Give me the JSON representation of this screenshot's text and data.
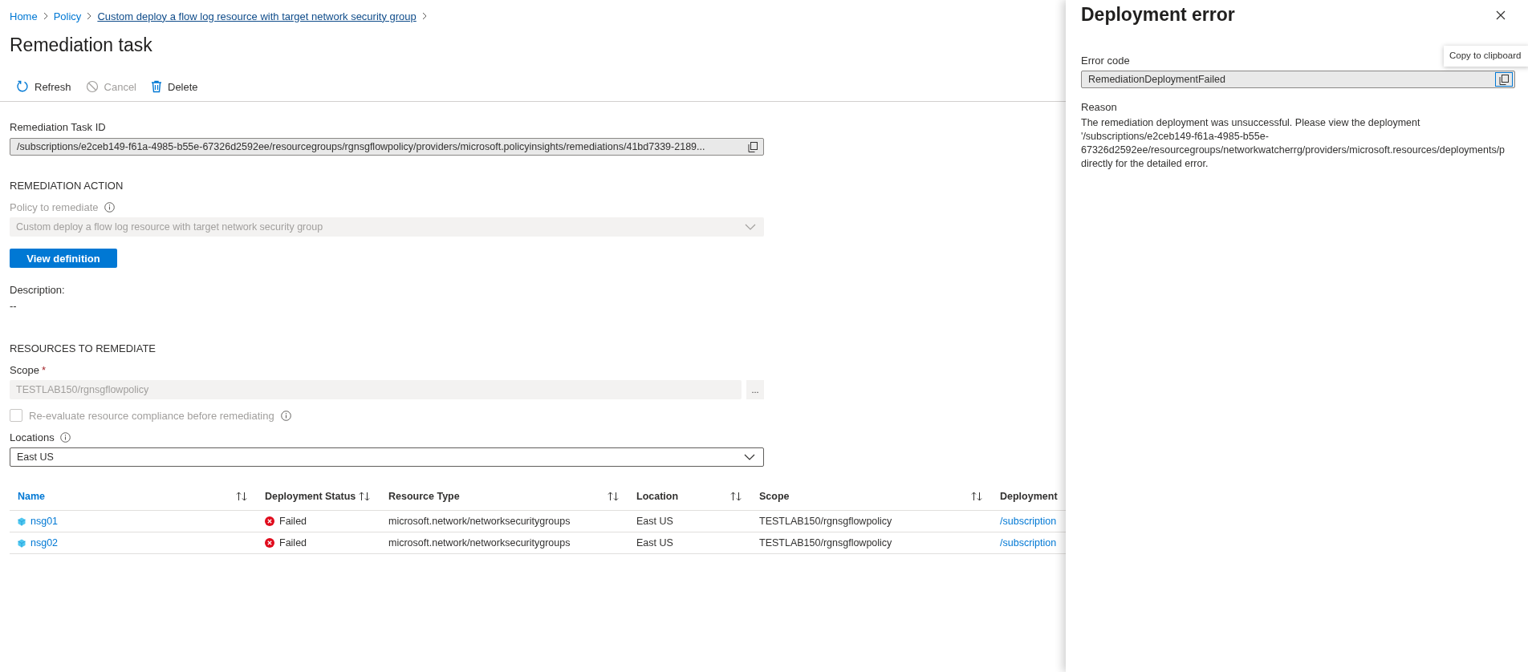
{
  "breadcrumb": [
    {
      "label": "Home",
      "kind": "link"
    },
    {
      "label": "Policy",
      "kind": "link"
    },
    {
      "label": "Custom deploy a flow log resource with target network security group",
      "kind": "underlined"
    }
  ],
  "page_title": "Remediation task",
  "toolbar": [
    {
      "label": "Refresh",
      "disabled": false
    },
    {
      "label": "Cancel",
      "disabled": true
    },
    {
      "label": "Delete",
      "disabled": false
    }
  ],
  "task_id": {
    "label": "Remediation Task ID",
    "value": "/subscriptions/e2ceb149-f61a-4985-b55e-67326d2592ee/resourcegroups/rgnsgflowpolicy/providers/microsoft.policyinsights/remediations/41bd7339-2189..."
  },
  "remediation_action": {
    "heading": "REMEDIATION ACTION",
    "policy_label": "Policy to remediate",
    "policy_value": "Custom deploy a flow log resource with target network security group",
    "policy_disabled": true,
    "button": "View definition",
    "description_label": "Description:",
    "description": "--"
  },
  "resources": {
    "heading": "RESOURCES TO REMEDIATE",
    "scope_label": "Scope",
    "scope_required_mark": "*",
    "scope_value": "TESTLAB150/rgnsgflowpolicy",
    "scope_button": "...",
    "reevaluate": {
      "label": "Re-evaluate resource compliance before remediating",
      "checked": false,
      "disabled": true
    },
    "locations_label": "Locations",
    "locations_value": "East US"
  },
  "table": {
    "columns": [
      {
        "label": "Name",
        "sortable": true,
        "kind": "link"
      },
      {
        "label": "Deployment Status",
        "sortable": true,
        "kind": "plain"
      },
      {
        "label": "Resource Type",
        "sortable": true,
        "kind": "plain"
      },
      {
        "label": "Location",
        "sortable": true,
        "kind": "plain"
      },
      {
        "label": "Scope",
        "sortable": true,
        "kind": "plain"
      },
      {
        "label": "Deployment",
        "sortable": false,
        "kind": "plain"
      }
    ],
    "rows": [
      {
        "name": "nsg01",
        "status": "Failed",
        "failed": true,
        "resource_type": "microsoft.network/networksecuritygroups",
        "location": "East US",
        "scope": "TESTLAB150/rgnsgflowpolicy",
        "deployment": "/subscription"
      },
      {
        "name": "nsg02",
        "status": "Failed",
        "failed": true,
        "resource_type": "microsoft.network/networksecuritygroups",
        "location": "East US",
        "scope": "TESTLAB150/rgnsgflowpolicy",
        "deployment": "/subscription"
      }
    ]
  },
  "panel": {
    "title": "Deployment error",
    "error_code_label": "Error code",
    "error_code": "RemediationDeploymentFailed",
    "tooltip": "Copy to clipboard",
    "reason_label": "Reason",
    "reason_lines": [
      "The remediation deployment was unsuccessful. Please view the deployment",
      "'/subscriptions/e2ceb149-f61a-4985-b55e-",
      "67326d2592ee/resourcegroups/networkwatcherrg/providers/microsoft.resources/deployments/p",
      "directly for the detailed error."
    ]
  }
}
